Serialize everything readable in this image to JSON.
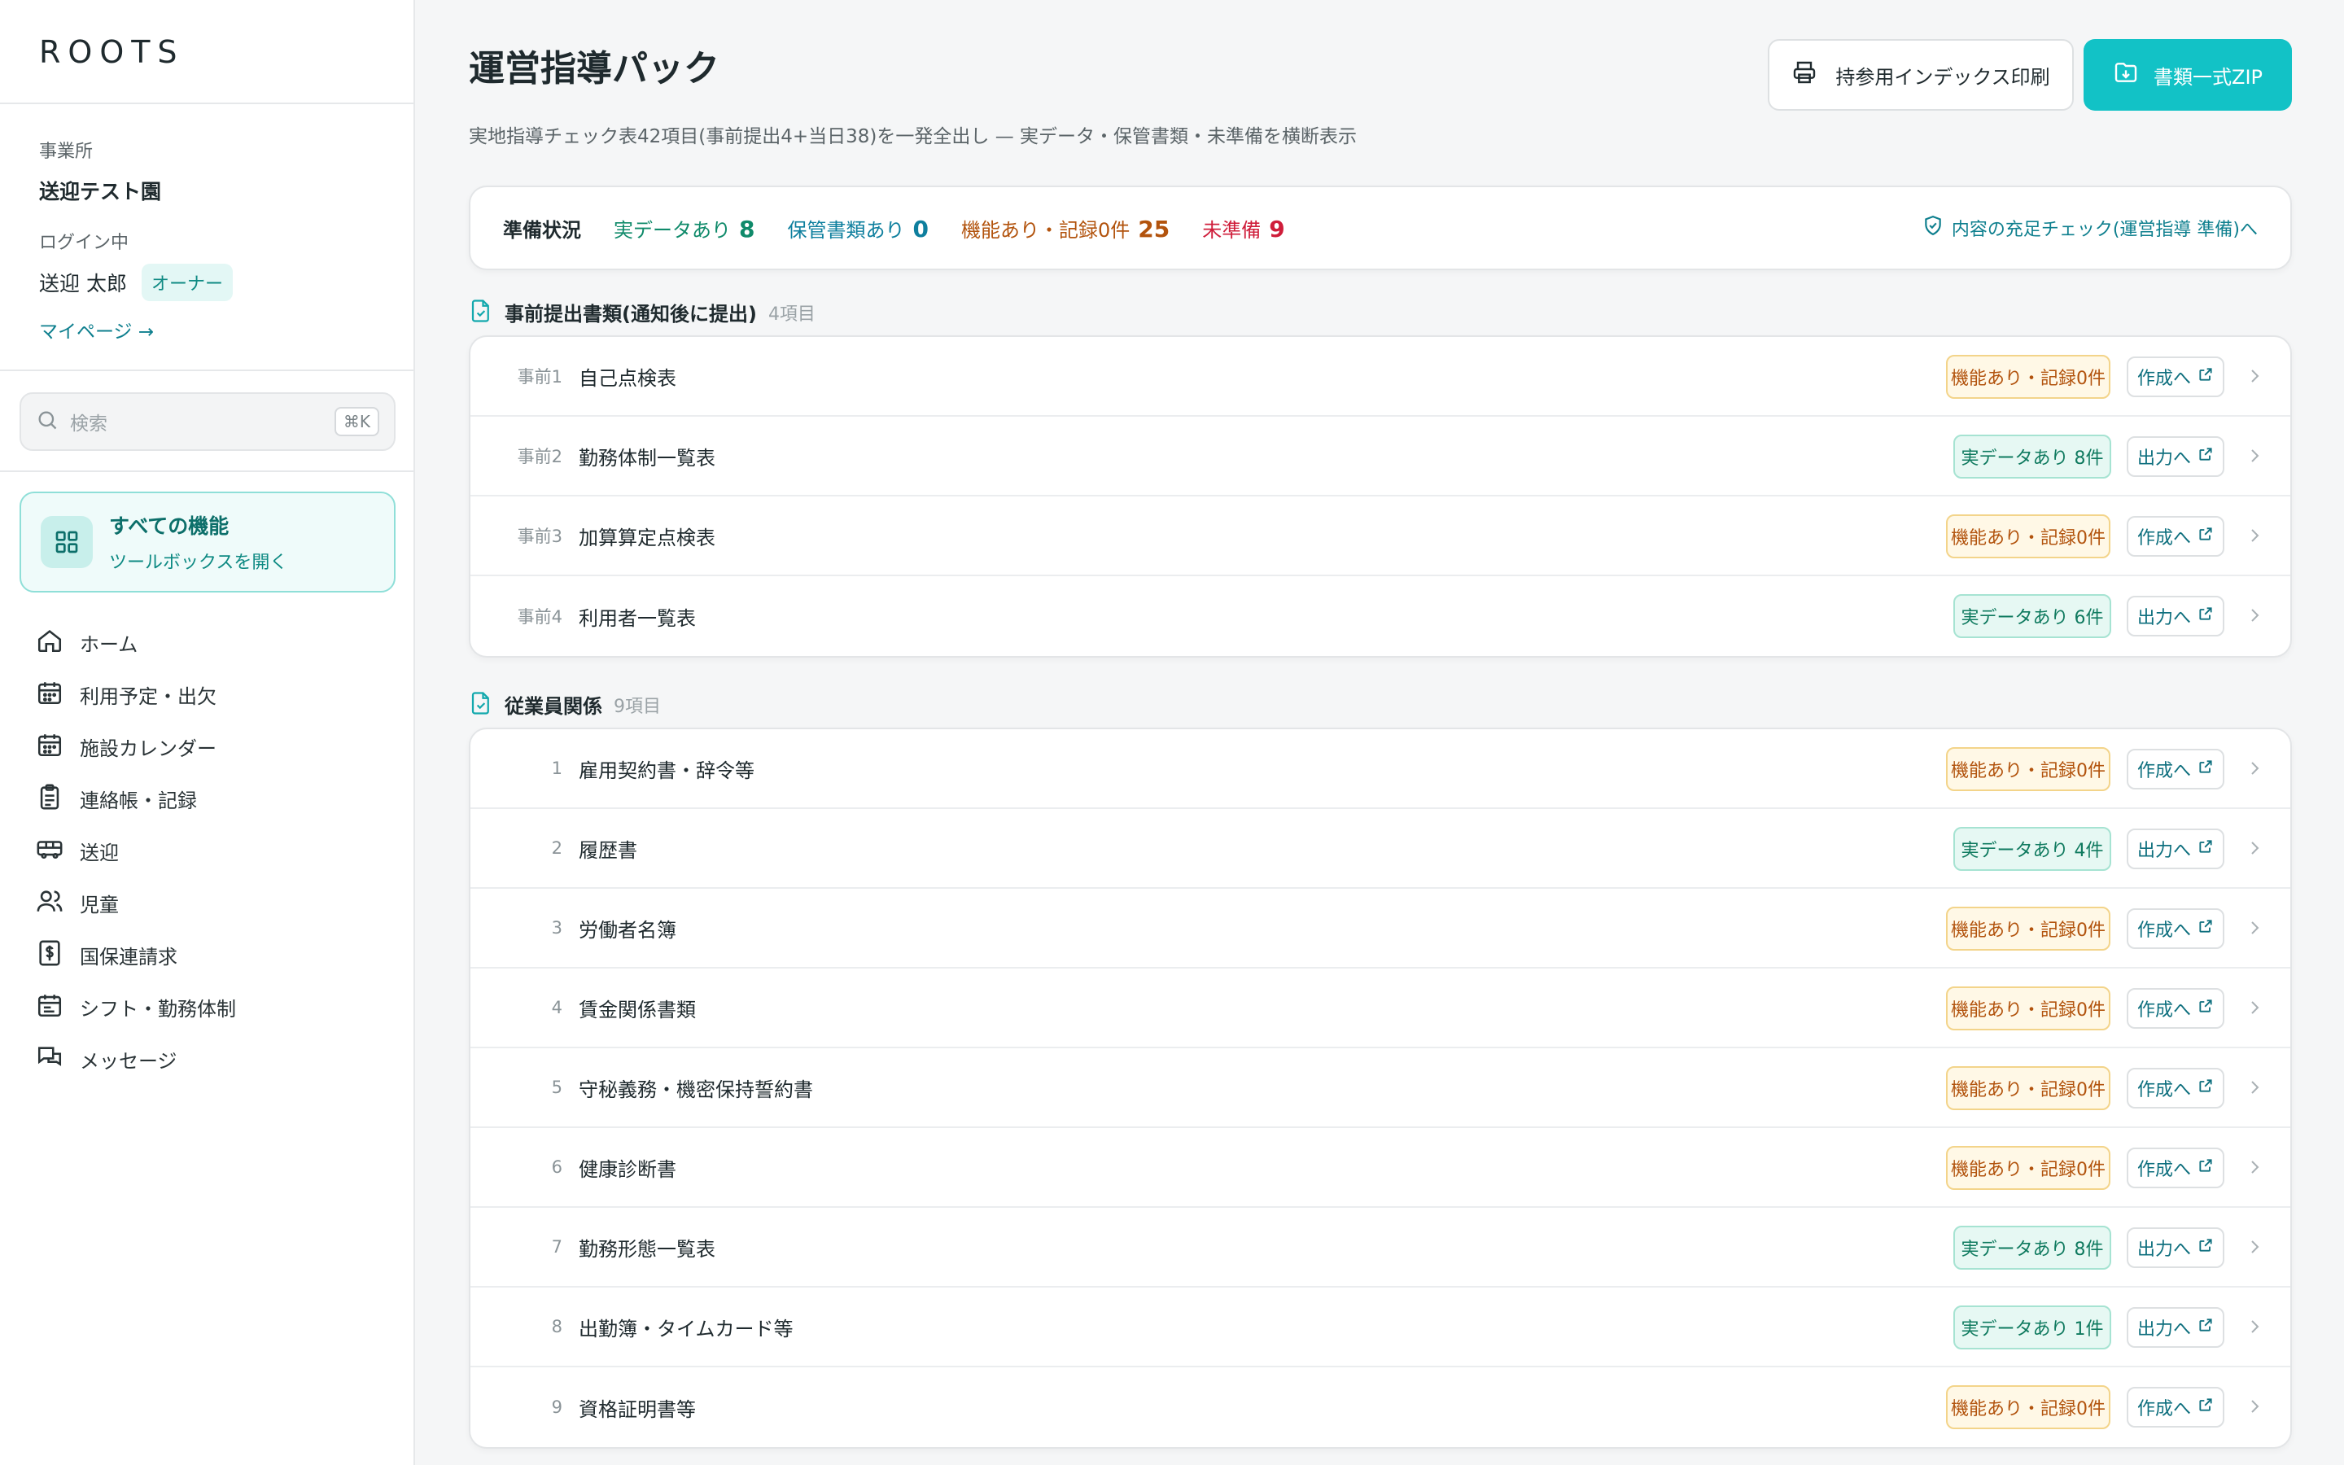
{
  "sidebar": {
    "logo": "ROOTS",
    "office_label": "事業所",
    "office_name": "送迎テスト園",
    "login_label": "ログイン中",
    "user_name": "送迎 太郎",
    "role_badge": "オーナー",
    "mypage_link": "マイページ →",
    "search": {
      "placeholder": "検索",
      "shortcut": "⌘K"
    },
    "all_functions": {
      "title": "すべての機能",
      "subtitle": "ツールボックスを開く"
    },
    "nav": [
      {
        "label": "ホーム",
        "icon": "home-icon"
      },
      {
        "label": "利用予定・出欠",
        "icon": "calendar-icon"
      },
      {
        "label": "施設カレンダー",
        "icon": "calendar-icon"
      },
      {
        "label": "連絡帳・記録",
        "icon": "clipboard-icon"
      },
      {
        "label": "送迎",
        "icon": "bus-icon"
      },
      {
        "label": "児童",
        "icon": "users-icon"
      },
      {
        "label": "国保連請求",
        "icon": "billing-icon"
      },
      {
        "label": "シフト・勤務体制",
        "icon": "schedule-icon"
      },
      {
        "label": "メッセージ",
        "icon": "message-icon"
      }
    ]
  },
  "header": {
    "title": "運営指導パック",
    "subtitle": "実地指導チェック表42項目(事前提出4+当日38)を一発全出し — 実データ・保管書類・未準備を横断表示",
    "print_button": "持参用インデックス印刷",
    "zip_button": "書類一式ZIP"
  },
  "status": {
    "label": "準備状況",
    "real_data_label": "実データあり",
    "real_data_count": "8",
    "stored_label": "保管書類あり",
    "stored_count": "0",
    "func_label": "機能あり・記録0件",
    "func_count": "25",
    "unprepared_label": "未準備",
    "unprepared_count": "9",
    "check_link": "内容の充足チェック(運営指導 準備)へ"
  },
  "sections": [
    {
      "title": "事前提出書類(通知後に提出)",
      "count": "4項目",
      "rows": [
        {
          "num": "事前1",
          "title": "自己点検表",
          "status": "機能あり・記録0件",
          "kind": "warn",
          "action": "作成へ"
        },
        {
          "num": "事前2",
          "title": "勤務体制一覧表",
          "status": "実データあり 8件",
          "kind": "ok",
          "action": "出力へ"
        },
        {
          "num": "事前3",
          "title": "加算算定点検表",
          "status": "機能あり・記録0件",
          "kind": "warn",
          "action": "作成へ"
        },
        {
          "num": "事前4",
          "title": "利用者一覧表",
          "status": "実データあり 6件",
          "kind": "ok",
          "action": "出力へ"
        }
      ]
    },
    {
      "title": "従業員関係",
      "count": "9項目",
      "rows": [
        {
          "num": "1",
          "title": "雇用契約書・辞令等",
          "status": "機能あり・記録0件",
          "kind": "warn",
          "action": "作成へ"
        },
        {
          "num": "2",
          "title": "履歴書",
          "status": "実データあり 4件",
          "kind": "ok",
          "action": "出力へ"
        },
        {
          "num": "3",
          "title": "労働者名簿",
          "status": "機能あり・記録0件",
          "kind": "warn",
          "action": "作成へ"
        },
        {
          "num": "4",
          "title": "賃金関係書類",
          "status": "機能あり・記録0件",
          "kind": "warn",
          "action": "作成へ"
        },
        {
          "num": "5",
          "title": "守秘義務・機密保持誓約書",
          "status": "機能あり・記録0件",
          "kind": "warn",
          "action": "作成へ"
        },
        {
          "num": "6",
          "title": "健康診断書",
          "status": "機能あり・記録0件",
          "kind": "warn",
          "action": "作成へ"
        },
        {
          "num": "7",
          "title": "勤務形態一覧表",
          "status": "実データあり 8件",
          "kind": "ok",
          "action": "出力へ"
        },
        {
          "num": "8",
          "title": "出勤簿・タイムカード等",
          "status": "実データあり 1件",
          "kind": "ok",
          "action": "出力へ"
        },
        {
          "num": "9",
          "title": "資格証明書等",
          "status": "機能あり・記録0件",
          "kind": "warn",
          "action": "作成へ"
        }
      ]
    }
  ]
}
